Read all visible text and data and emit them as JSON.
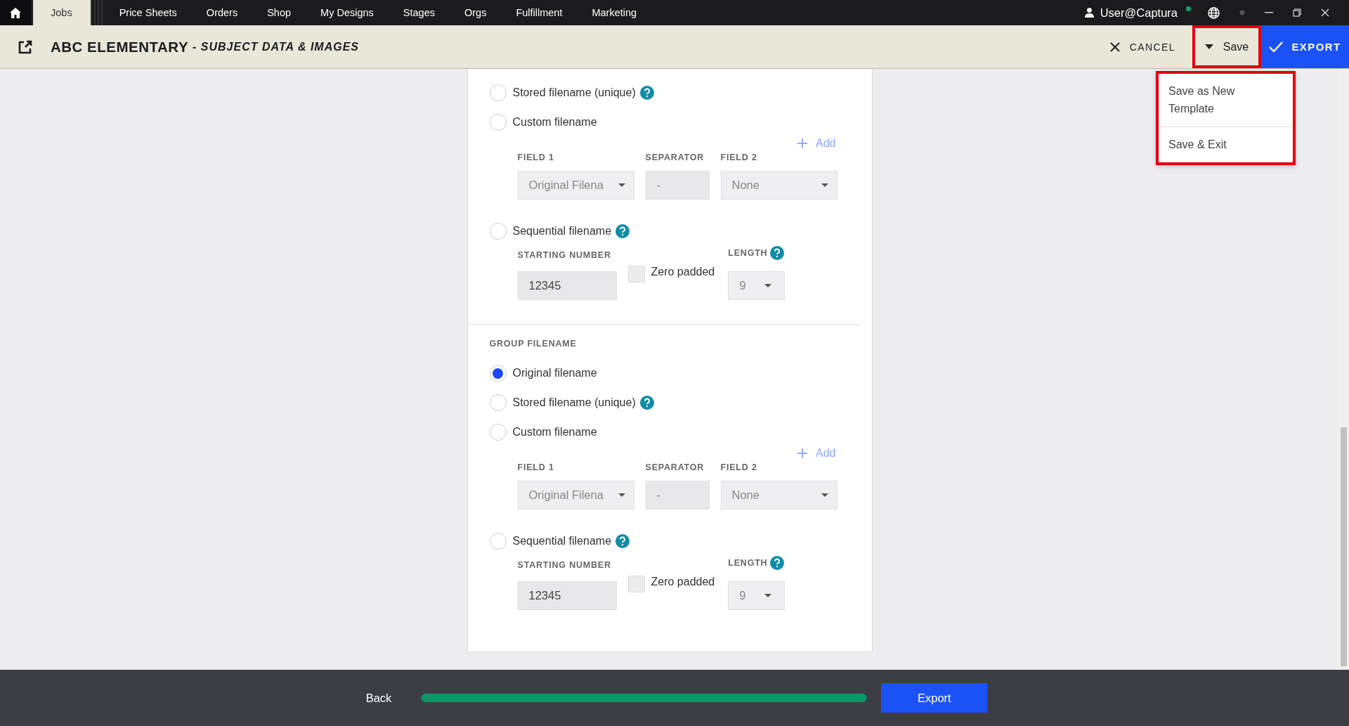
{
  "top_nav": {
    "tabs": [
      {
        "label": "Jobs",
        "selected": true
      },
      {
        "label": "Price Sheets",
        "selected": false
      },
      {
        "label": "Orders",
        "selected": false
      },
      {
        "label": "Shop",
        "selected": false
      },
      {
        "label": "My Designs",
        "selected": false
      },
      {
        "label": "Stages",
        "selected": false
      },
      {
        "label": "Orgs",
        "selected": false
      },
      {
        "label": "Fulfillment",
        "selected": false
      },
      {
        "label": "Marketing",
        "selected": false
      }
    ],
    "user": "User@Captura"
  },
  "header": {
    "title": "ABC ELEMENTARY",
    "subtitle": "- SUBJECT DATA & IMAGES",
    "cancel": "CANCEL",
    "save": {
      "label": "Save",
      "highlighted": true
    },
    "export": "EXPORT"
  },
  "save_menu": {
    "highlighted": true,
    "items": [
      "Save as New Template",
      "Save & Exit"
    ]
  },
  "sections": [
    {
      "options": [
        {
          "kind": "plain",
          "label": "Stored filename (unique)",
          "selected": false,
          "help": true
        },
        {
          "kind": "custom",
          "label": "Custom filename",
          "selected": false,
          "help": false,
          "add": "Add",
          "field1_label": "FIELD 1",
          "field1_value": "Original Filena",
          "separator_label": "SEPARATOR",
          "separator_value": "-",
          "field2_label": "FIELD 2",
          "field2_value": "None"
        },
        {
          "kind": "sequential",
          "label": "Sequential filename",
          "selected": false,
          "help": true,
          "start_label": "STARTING NUMBER",
          "start_value": "12345",
          "zero_label": "Zero padded",
          "zero_checked": false,
          "length_label": "LENGTH",
          "length_value": "9"
        }
      ]
    },
    {
      "heading": "GROUP FILENAME",
      "options": [
        {
          "kind": "plain",
          "label": "Original filename",
          "selected": true,
          "help": false
        },
        {
          "kind": "plain",
          "label": "Stored filename (unique)",
          "selected": false,
          "help": true
        },
        {
          "kind": "custom",
          "label": "Custom filename",
          "selected": false,
          "help": false,
          "add": "Add",
          "field1_label": "FIELD 1",
          "field1_value": "Original Filena",
          "separator_label": "SEPARATOR",
          "separator_value": "-",
          "field2_label": "FIELD 2",
          "field2_value": "None"
        },
        {
          "kind": "sequential",
          "label": "Sequential filename",
          "selected": false,
          "help": true,
          "start_label": "STARTING NUMBER",
          "start_value": "12345",
          "zero_label": "Zero padded",
          "zero_checked": false,
          "length_label": "LENGTH",
          "length_value": "9"
        }
      ]
    }
  ],
  "footer": {
    "back": "Back",
    "progress": {
      "level": 1
    },
    "export": "Export"
  }
}
